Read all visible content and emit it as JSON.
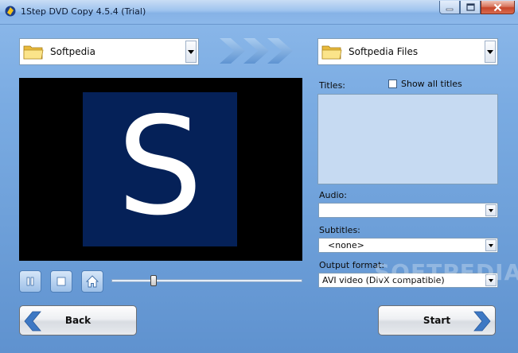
{
  "window": {
    "title": "1Step DVD Copy 4.5.4 (Trial)"
  },
  "source": {
    "selected": "Softpedia",
    "icon": "folder-icon"
  },
  "destination": {
    "selected": "Softpedia Files",
    "icon": "folder-icon"
  },
  "preview": {
    "logo_letter": "S"
  },
  "player": {
    "position_fraction": 0.22
  },
  "panel": {
    "titles_label": "Titles:",
    "show_all_label": "Show all titles",
    "show_all_checked": false,
    "audio_label": "Audio:",
    "audio_value": "",
    "subtitles_label": "Subtitles:",
    "subtitles_value": "<none>",
    "output_format_label": "Output format:",
    "output_format_value": "AVI video (DivX compatible)"
  },
  "buttons": {
    "back": "Back",
    "start": "Start"
  },
  "watermark": "SOFTPEDIA",
  "colors": {
    "accent": "#2f6fc0",
    "preview_bg": "#052158",
    "titles_bg": "#c6daf2"
  }
}
